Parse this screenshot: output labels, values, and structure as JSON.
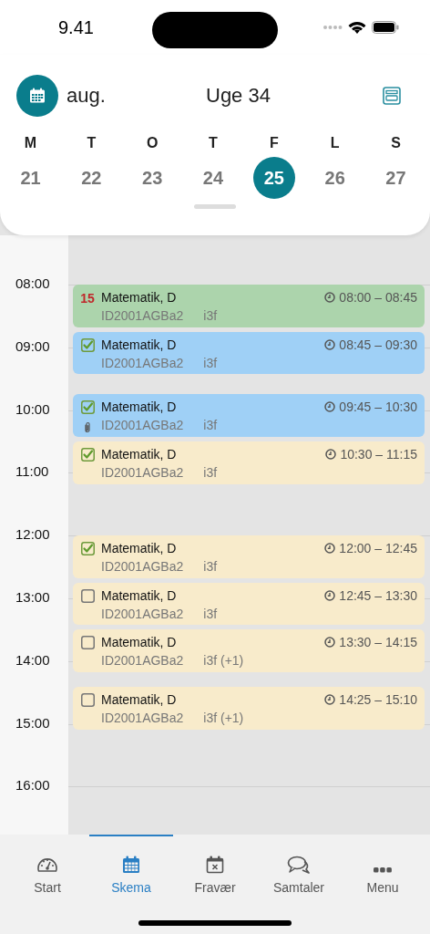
{
  "status_bar": {
    "time": "9.41"
  },
  "header": {
    "month": "aug.",
    "week": "Uge 34"
  },
  "days": [
    {
      "letter": "M",
      "date": "21",
      "selected": false
    },
    {
      "letter": "T",
      "date": "22",
      "selected": false
    },
    {
      "letter": "O",
      "date": "23",
      "selected": false
    },
    {
      "letter": "T",
      "date": "24",
      "selected": false
    },
    {
      "letter": "F",
      "date": "25",
      "selected": true
    },
    {
      "letter": "L",
      "date": "26",
      "selected": false
    },
    {
      "letter": "S",
      "date": "27",
      "selected": false
    }
  ],
  "hours": [
    "08:00",
    "09:00",
    "10:00",
    "11:00",
    "12:00",
    "13:00",
    "14:00",
    "15:00",
    "16:00"
  ],
  "lessons": [
    {
      "title": "Matematik, D",
      "code": "ID2001AGBa2",
      "room": "i3f",
      "time": "08:00 – 08:45",
      "color": "#acd4ac",
      "marker": {
        "kind": "count",
        "text": "15"
      },
      "attachment": false
    },
    {
      "title": "Matematik, D",
      "code": "ID2001AGBa2",
      "room": "i3f",
      "time": "08:45 – 09:30",
      "color": "#9fd0f6",
      "marker": {
        "kind": "checkbox",
        "checked": true
      },
      "attachment": false
    },
    {
      "title": "Matematik, D",
      "code": "ID2001AGBa2",
      "room": "i3f",
      "time": "09:45 – 10:30",
      "color": "#9fd0f6",
      "marker": {
        "kind": "checkbox",
        "checked": true
      },
      "attachment": true
    },
    {
      "title": "Matematik, D",
      "code": "ID2001AGBa2",
      "room": "i3f",
      "time": "10:30 – 11:15",
      "color": "#f8ebcb",
      "marker": {
        "kind": "checkbox",
        "checked": true
      },
      "attachment": false
    },
    {
      "title": "Matematik, D",
      "code": "ID2001AGBa2",
      "room": "i3f",
      "time": "12:00 – 12:45",
      "color": "#f8ebcb",
      "marker": {
        "kind": "checkbox",
        "checked": true
      },
      "attachment": false
    },
    {
      "title": "Matematik, D",
      "code": "ID2001AGBa2",
      "room": "i3f",
      "time": "12:45 – 13:30",
      "color": "#f8ebcb",
      "marker": {
        "kind": "checkbox",
        "checked": false
      },
      "attachment": false
    },
    {
      "title": "Matematik, D",
      "code": "ID2001AGBa2",
      "room": "i3f (+1)",
      "time": "13:30 – 14:15",
      "color": "#f8ebcb",
      "marker": {
        "kind": "checkbox",
        "checked": false
      },
      "attachment": false
    },
    {
      "title": "Matematik, D",
      "code": "ID2001AGBa2",
      "room": "i3f (+1)",
      "time": "14:25 – 15:10",
      "color": "#f8ebcb",
      "marker": {
        "kind": "checkbox",
        "checked": false
      },
      "attachment": false
    }
  ],
  "tabs": [
    {
      "label": "Start",
      "kind": "dashboard",
      "selected": false
    },
    {
      "label": "Skema",
      "kind": "calendar",
      "selected": true
    },
    {
      "label": "Fravær",
      "kind": "absence",
      "selected": false
    },
    {
      "label": "Samtaler",
      "kind": "chat",
      "selected": false
    },
    {
      "label": "Menu",
      "kind": "more",
      "selected": false
    }
  ]
}
